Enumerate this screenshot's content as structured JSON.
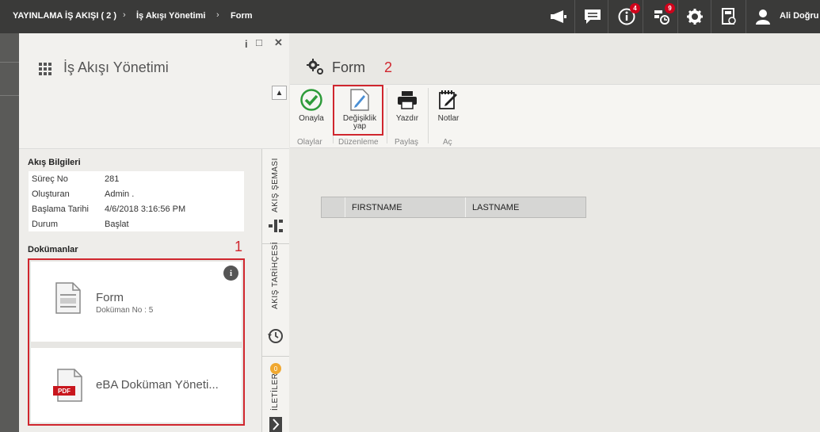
{
  "topbar": {
    "breadcrumb": [
      "YAYINLAMA İŞ AKIŞI ( 2 )",
      "İş Akışı Yönetimi",
      "Form"
    ],
    "icons": [
      {
        "name": "megaphone-icon"
      },
      {
        "name": "message-icon"
      },
      {
        "name": "info-icon",
        "badge": "4"
      },
      {
        "name": "workflow-task-icon",
        "badge": "9"
      },
      {
        "name": "gear-icon"
      },
      {
        "name": "calculator-icon"
      }
    ],
    "user_name": "Ali Doğru"
  },
  "left_panel": {
    "title": "İş Akışı Yönetimi",
    "flow_info": {
      "heading": "Akış Bilgileri",
      "rows": [
        {
          "label": "Süreç No",
          "value": "281"
        },
        {
          "label": "Oluşturan",
          "value": "Admin ."
        },
        {
          "label": "Başlama Tarihi",
          "value": "4/6/2018 3:16:56 PM"
        },
        {
          "label": "Durum",
          "value": "Başlat"
        }
      ]
    },
    "documents": {
      "heading": "Dokümanlar",
      "items": [
        {
          "title": "Form",
          "subtitle": "Doküman No : 5"
        },
        {
          "title": "eBA Doküman Yöneti...",
          "icon_text": "PDF"
        }
      ]
    },
    "marker": "1"
  },
  "vertical_tabs": [
    {
      "label": "AKIŞ ŞEMASI"
    },
    {
      "label": "AKIŞ TARİHÇESİ"
    },
    {
      "label": "İLETİLER",
      "badge": "0"
    }
  ],
  "right_panel": {
    "title": "Form",
    "marker": "2",
    "ribbon": {
      "buttons": [
        {
          "label": "Onayla"
        },
        {
          "label": "Değişiklik yap"
        },
        {
          "label": "Yazdır"
        },
        {
          "label": "Notlar"
        }
      ],
      "groups": [
        "Olaylar",
        "Düzenleme",
        "Paylaş",
        "Aç"
      ]
    },
    "grid": {
      "columns": [
        "FIRSTNAME",
        "LASTNAME"
      ]
    }
  },
  "colors": {
    "topbar": "#3a3a39",
    "highlight": "#d0262e",
    "approve": "#2e9b3a"
  }
}
